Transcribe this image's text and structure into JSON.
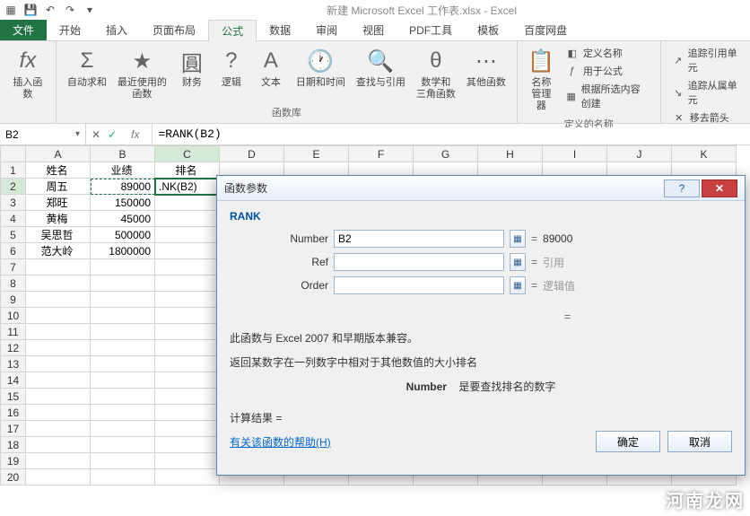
{
  "window": {
    "title": "新建 Microsoft Excel 工作表.xlsx - Excel"
  },
  "qat": {
    "save": "💾",
    "undo": "↶",
    "redo": "↷"
  },
  "tabs": {
    "file": "文件",
    "home": "开始",
    "insert": "插入",
    "page_layout": "页面布局",
    "formulas": "公式",
    "data": "数据",
    "review": "审阅",
    "view": "视图",
    "pdf": "PDF工具",
    "template": "模板",
    "baidu": "百度网盘"
  },
  "ribbon": {
    "insert_function": "插入函数",
    "autosum": "自动求和",
    "recent": "最近使用的\n函数",
    "financial": "财务",
    "logical": "逻辑",
    "text": "文本",
    "date_time": "日期和时间",
    "lookup": "查找与引用",
    "math_trig": "数学和\n三角函数",
    "more": "其他函数",
    "group_library": "函数库",
    "name_manager": "名称\n管理器",
    "define_name": "定义名称",
    "use_in_formula": "用于公式",
    "create_from_sel": "根据所选内容创建",
    "group_defined": "定义的名称",
    "trace_prec": "追踪引用单元",
    "trace_dep": "追踪从属单元",
    "remove_arrows": "移去箭头"
  },
  "namebox": {
    "value": "B2"
  },
  "formula": {
    "fx": "fx",
    "value": "=RANK(B2)"
  },
  "columns": [
    "A",
    "B",
    "C",
    "D",
    "E",
    "F",
    "G",
    "H",
    "I",
    "J",
    "K"
  ],
  "rows_count": 20,
  "cells": {
    "headers": {
      "a1": "姓名",
      "b1": "业绩",
      "c1": "排名"
    },
    "data": [
      {
        "name": "周五",
        "val": "89000",
        "rank": ".NK(B2)"
      },
      {
        "name": "郑旺",
        "val": "150000",
        "rank": ""
      },
      {
        "name": "黄梅",
        "val": "45000",
        "rank": ""
      },
      {
        "name": "吴思哲",
        "val": "500000",
        "rank": ""
      },
      {
        "name": "范大岭",
        "val": "1800000",
        "rank": ""
      }
    ]
  },
  "dialog": {
    "title": "函数参数",
    "func": "RANK",
    "args": {
      "number_label": "Number",
      "number_value": "B2",
      "number_result": "89000",
      "ref_label": "Ref",
      "ref_value": "",
      "ref_result": "引用",
      "order_label": "Order",
      "order_value": "",
      "order_result": "逻辑值"
    },
    "eq": "=",
    "desc1": "此函数与 Excel 2007 和早期版本兼容。",
    "desc2": "返回某数字在一列数字中相对于其他数值的大小排名",
    "arg_desc_label": "Number",
    "arg_desc": "是要查找排名的数字",
    "result_label": "计算结果 =",
    "help_link": "有关该函数的帮助(H)",
    "ok": "确定",
    "cancel": "取消"
  },
  "watermark": "河南龙网"
}
